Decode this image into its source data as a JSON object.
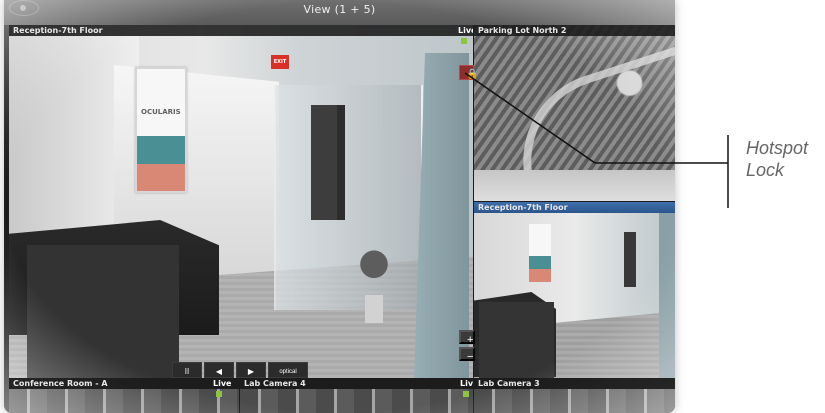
{
  "header": {
    "title": "View (1 + 5)"
  },
  "cameras": {
    "main": {
      "label": "Reception-7th Floor",
      "status": "Live",
      "poster_text": "OCULARIS"
    },
    "top_right": {
      "label": "Parking Lot North 2"
    },
    "middle_right": {
      "label": "Reception-7th Floor"
    },
    "bottom_left": {
      "label": "Conference Room - A",
      "status": "Live"
    },
    "bottom_middle": {
      "label": "Lab Camera 4",
      "status": "Live"
    },
    "bottom_right": {
      "label": "Lab Camera 3"
    }
  },
  "controls": {
    "pause": "II",
    "previous": "◀",
    "next": "▶",
    "optical": "optical"
  },
  "zoom": {
    "plus": "+",
    "minus": "−"
  },
  "callout": {
    "label": "Hotspot Lock"
  },
  "icons": {
    "hotspot_lock": "lock-icon",
    "logo": "camera-logo-icon"
  },
  "colors": {
    "live_indicator": "#8cc33f",
    "selected_camera_header": "#3f6fab",
    "hotspot_lock": "#8f2d2d",
    "callout_text": "#666666"
  }
}
